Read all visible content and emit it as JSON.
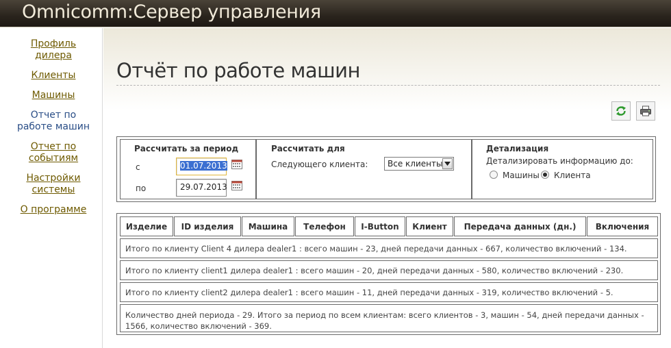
{
  "header": {
    "app_title": "Omnicomm:Сервер управления"
  },
  "sidebar": {
    "items": [
      {
        "label": "Профиль дилера",
        "active": false
      },
      {
        "label": "Клиенты",
        "active": false
      },
      {
        "label": "Машины",
        "active": false
      },
      {
        "label": "Отчет по работе машин",
        "active": true
      },
      {
        "label": "Отчет по событиям",
        "active": false
      },
      {
        "label": "Настройки системы",
        "active": false
      },
      {
        "label": "О программе",
        "active": false
      }
    ]
  },
  "page": {
    "title": "Отчёт по работе машин"
  },
  "toolbar": {
    "refresh_icon": "refresh-icon",
    "print_icon": "print-icon"
  },
  "period": {
    "heading": "Рассчитать за период",
    "from_label": "с",
    "from_value": "01.07.2013",
    "to_label": "по",
    "to_value": "29.07.2013"
  },
  "calc_for": {
    "heading": "Рассчитать для",
    "client_label": "Следующего клиента:",
    "client_selected": "Все клиенты"
  },
  "detail": {
    "heading": "Детализация",
    "label": "Детализировать информацию до:",
    "options": [
      {
        "label": "Машины",
        "checked": false
      },
      {
        "label": "Клиента",
        "checked": true
      }
    ]
  },
  "report": {
    "columns": [
      "Изделие",
      "ID изделия",
      "Машина",
      "Телефон",
      "I-Button",
      "Клиент",
      "Передача данных (дн.)",
      "Включения"
    ],
    "rows": [
      "Итого по клиенту Client 4 дилера dealer1 : всего машин - 23, дней передачи данных - 667, количество включений - 134.",
      "Итого по клиенту client1 дилера dealer1 : всего машин - 20, дней передачи данных - 580, количество включений - 230.",
      "Итого по клиенту client2 дилера dealer1 : всего машин - 11, дней передачи данных - 319, количество включений - 5.",
      "Количество дней периода - 29. Итого за период по всем клиентам: всего клиентов - 3, машин - 54, дней передачи данных - 1566, количество включений - 369."
    ]
  },
  "colors": {
    "header_bg": "#2a241d",
    "header_text": "#f1ead9",
    "nav_link": "#6e5a00",
    "nav_active": "#294d86",
    "selection": "#3b6fd1"
  }
}
